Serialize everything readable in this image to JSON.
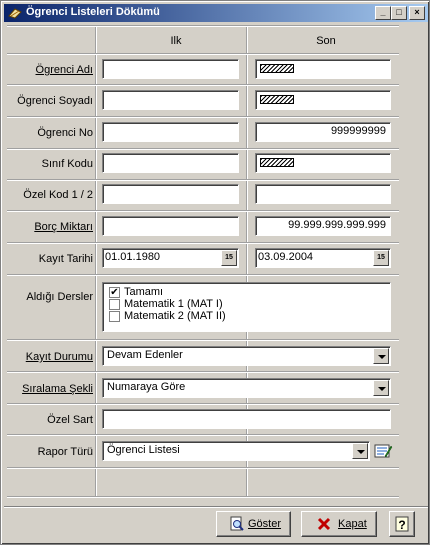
{
  "window": {
    "title": "Ögrenci Listeleri Dökümü",
    "minimize": "_",
    "maximize": "□",
    "close": "×"
  },
  "columns": {
    "first": "Ilk",
    "last": "Son"
  },
  "rows": {
    "ogrenci_adi": {
      "label": "Ögrenci Adı",
      "first": "",
      "last": ""
    },
    "ogrenci_soyadi": {
      "label": "Ögrenci Soyadı",
      "first": "",
      "last": ""
    },
    "ogrenci_no": {
      "label": "Ögrenci No",
      "first": "",
      "last": "999999999"
    },
    "sinif_kodu": {
      "label": "Sınıf Kodu",
      "first": "",
      "last": ""
    },
    "ozel_kod": {
      "label": "Özel Kod 1 / 2",
      "first": "",
      "last": ""
    },
    "borc_miktari": {
      "label": "Borç Miktarı",
      "first": "",
      "last": "99.999.999.999.999"
    },
    "kayit_tarihi": {
      "label": "Kayıt Tarihi",
      "first": "01.01.1980",
      "last": "03.09.2004",
      "cal": "15"
    }
  },
  "dersler": {
    "label": "Aldığı Dersler",
    "items": [
      {
        "label": "Tamamı",
        "checked": "✔"
      },
      {
        "label": "Matematik 1 (MAT I)",
        "checked": ""
      },
      {
        "label": "Matematik 2 (MAT II)",
        "checked": ""
      }
    ]
  },
  "kayit_durumu": {
    "label": "Kayıt Durumu",
    "value": "Devam Edenler"
  },
  "siralama": {
    "label": "Sıralama Şekli",
    "value": "Numaraya Göre"
  },
  "ozel_sart": {
    "label": "Özel Sart",
    "value": ""
  },
  "rapor_turu": {
    "label": "Rapor Türü",
    "value": "Ögrenci Listesi"
  },
  "buttons": {
    "goster": "Göster",
    "kapat": "Kapat"
  }
}
